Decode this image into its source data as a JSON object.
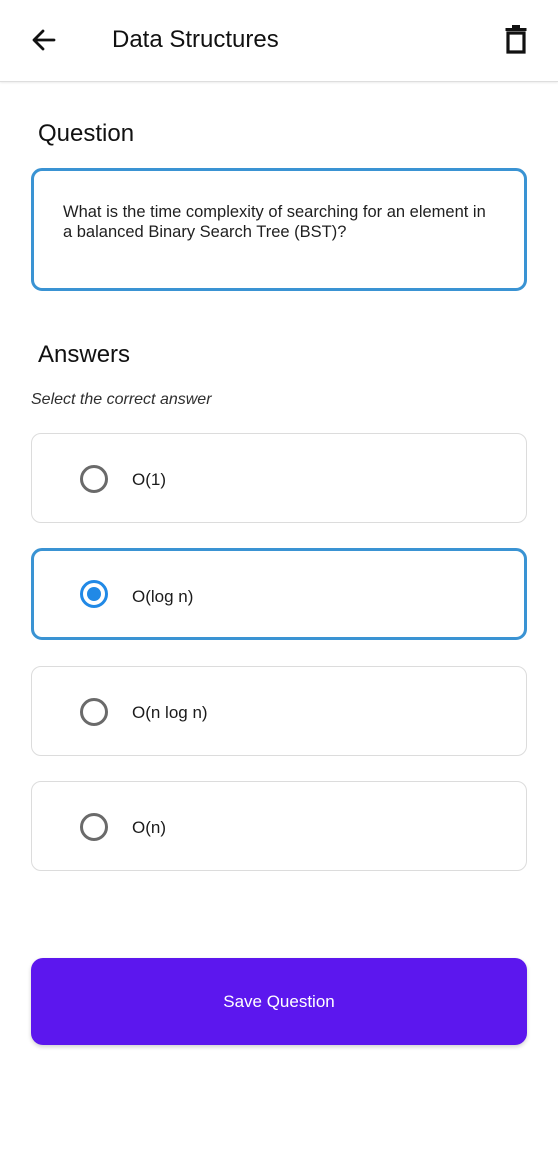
{
  "header": {
    "title": "Data Structures",
    "back_icon": "arrow-left-icon",
    "delete_icon": "trash-icon"
  },
  "question": {
    "heading": "Question",
    "text": "What is the time complexity of searching for an element in a balanced Binary Search Tree (BST)?"
  },
  "answers": {
    "heading": "Answers",
    "instruction": "Select the correct answer",
    "selected_index": 1,
    "options": [
      {
        "label": "O(1)",
        "selected": false
      },
      {
        "label": "O(log n)",
        "selected": true
      },
      {
        "label": "O(n log n)",
        "selected": false
      },
      {
        "label": "O(n)",
        "selected": false
      }
    ]
  },
  "footer": {
    "save_label": "Save Question"
  },
  "colors": {
    "accent": "#3a93d3",
    "radio_selected": "#2189e6",
    "primary_button": "#5c17ee",
    "text": "#111111"
  }
}
